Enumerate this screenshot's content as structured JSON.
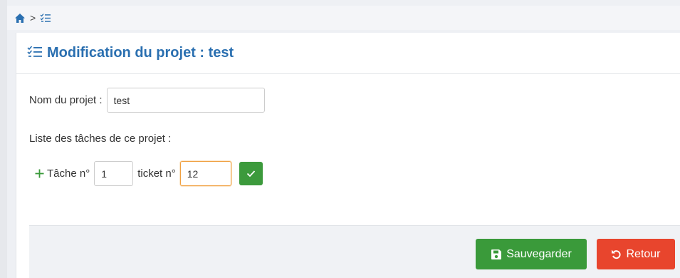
{
  "breadcrumb": {
    "separator": ">",
    "home_icon": "home-icon",
    "list_icon": "task-list-icon"
  },
  "header": {
    "title": "Modification du projet : test",
    "icon": "task-list-icon"
  },
  "form": {
    "project_name_label": "Nom du projet :",
    "project_name_value": "test",
    "tasks_label": "Liste des tâches de ce projet :",
    "task_label": "Tâche n°",
    "task_number_value": "1",
    "ticket_label": "ticket n°",
    "ticket_number_value": "12"
  },
  "footer": {
    "save_label": "Sauvegarder",
    "back_label": "Retour"
  },
  "colors": {
    "accent_blue": "#2a6fb0",
    "success_green": "#3a9a3a",
    "danger_red": "#e8452d"
  }
}
